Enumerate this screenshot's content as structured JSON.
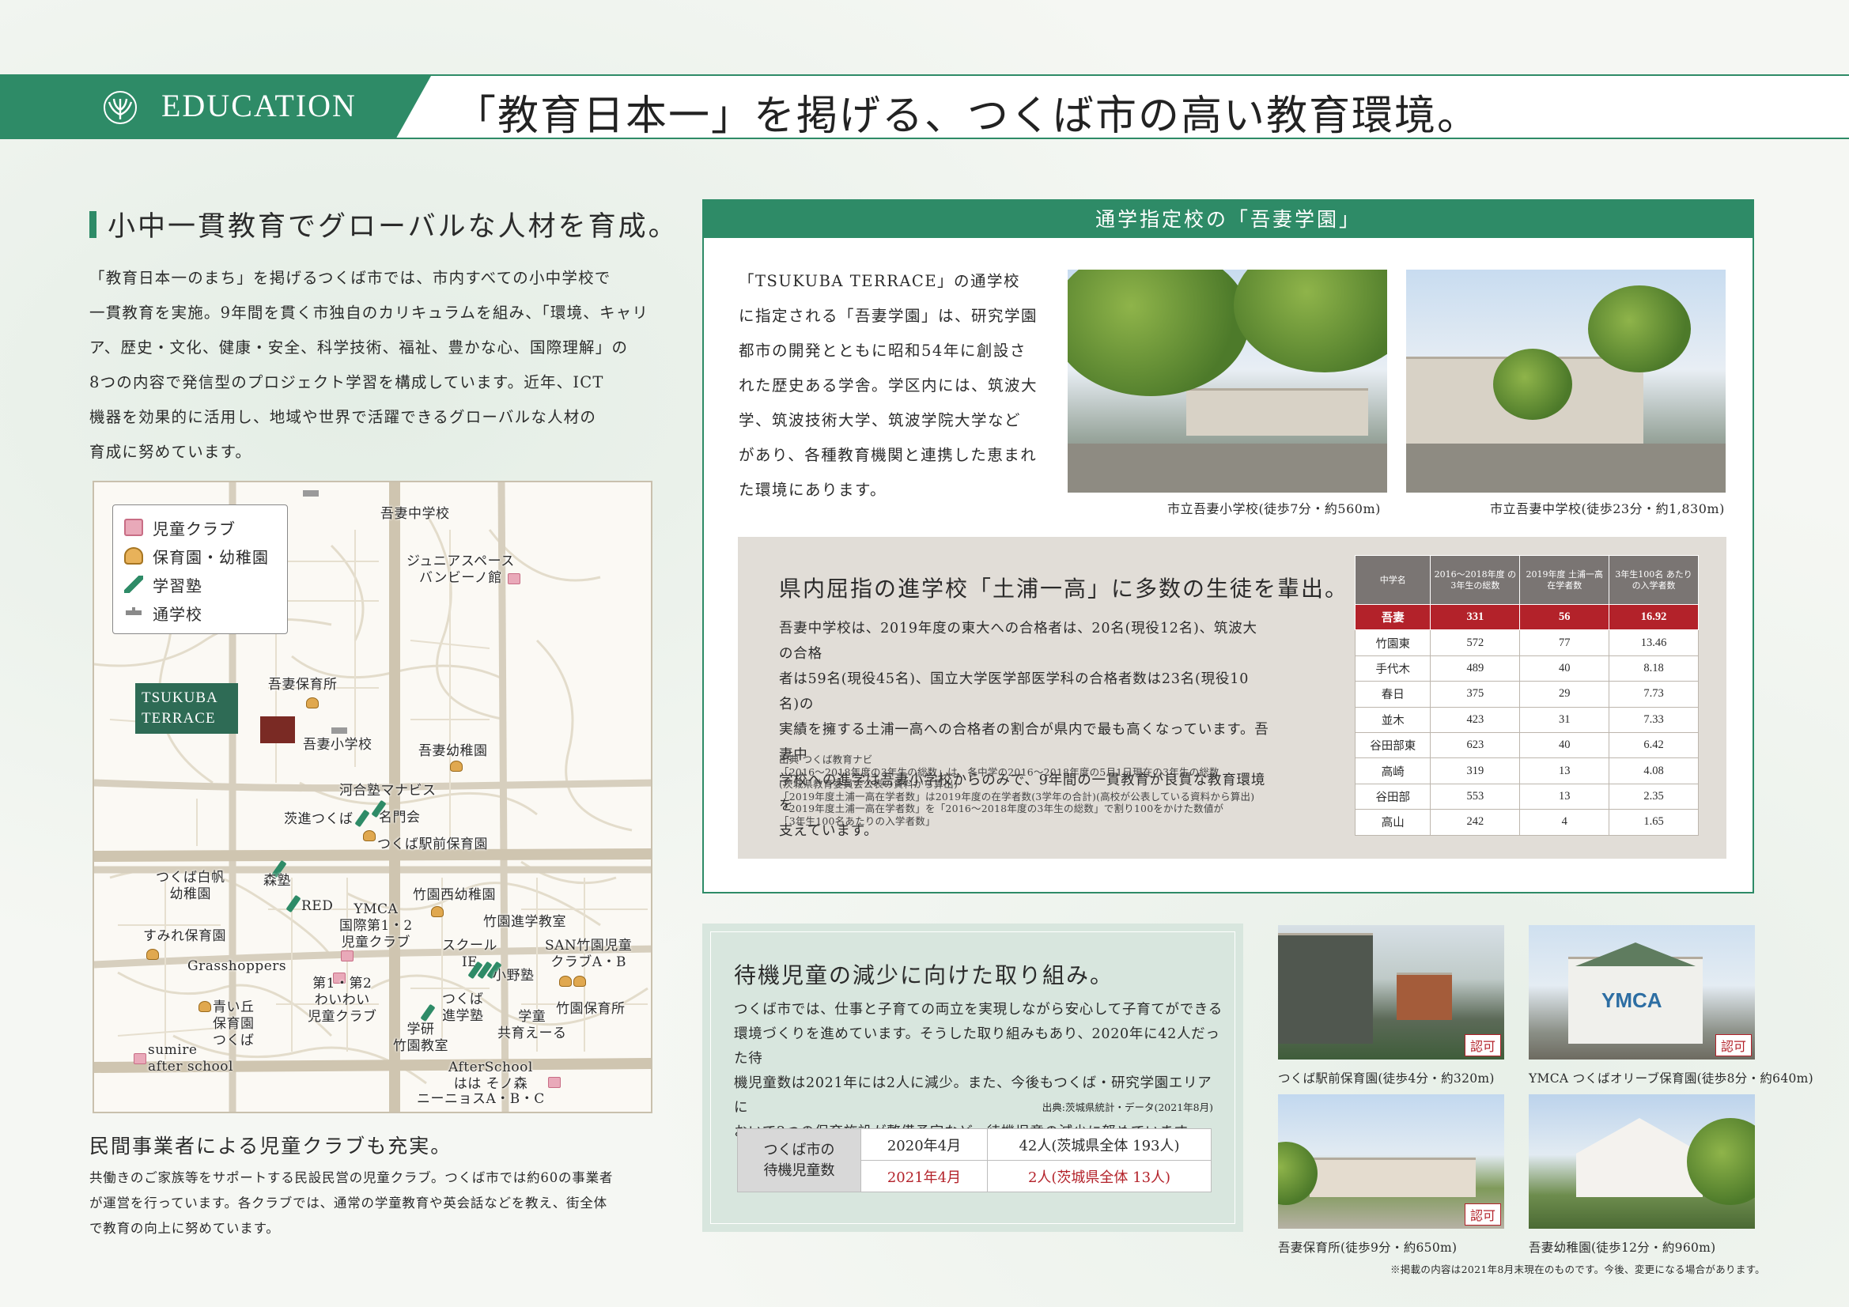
{
  "header": {
    "tag": "EDUCATION",
    "headline": "「教育日本一」を掲げる、つくば市の高い教育環境。"
  },
  "left": {
    "title": "小中一貫教育でグローバルな人材を育成。",
    "lines": [
      "「教育日本一のまち」を掲げるつくば市では、市内すべての小中学校で",
      "一貫教育を実施。9年間を貫く市独自のカリキュラムを組み、「環境、キャリ",
      "ア、歴史・文化、健康・安全、科学技術、福祉、豊かな心、国際理解」の",
      "8つの内容で発信型のプロジェクト学習を構成しています。近年、ICT",
      "機器を効果的に活用し、地域や世界で活躍できるグローバルな人材の",
      "育成に努めています。"
    ],
    "sub_title": "民間事業者による児童クラブも充実。",
    "sub_lines": [
      "共働きのご家族等をサポートする民設民営の児童クラブ。つくば市では約60の事業者",
      "が運営を行っています。各クラブでは、通常の学童教育や英会話などを教え、街全体",
      "で教育の向上に努めています。"
    ]
  },
  "map": {
    "legend": [
      "児童クラブ",
      "保育園・幼稚園",
      "学習塾",
      "通学校"
    ],
    "property": [
      "TSUKUBA",
      "TERRACE"
    ],
    "labels": {
      "azuma_jhs": "吾妻中学校",
      "junior_space": [
        "ジュニアスペース",
        "バンビーノ館"
      ],
      "azuma_nursery": "吾妻保育所",
      "azuma_es": "吾妻小学校",
      "azuma_kg": "吾妻幼稚園",
      "kawai": "河合塾マナビス",
      "ibashin": "茨進つくば",
      "meimonkai": "名門会",
      "station_nursery": "つくば駅前保育園",
      "shiraho": [
        "つくば白帆",
        "幼稚園"
      ],
      "morijuku": "森塾",
      "red": "RED",
      "takezono_kg": "竹園西幼稚園",
      "ymca": [
        "YMCA",
        "国際第1・2",
        "児童クラブ"
      ],
      "takezono_shingaku": "竹園進学教室",
      "sumire": "すみれ保育園",
      "grasshoppers": "Grasshoppers",
      "school_ie": [
        "スクール",
        "IE"
      ],
      "onojuku": "小野塾",
      "san": [
        "SAN竹園児童",
        "クラブA・B"
      ],
      "waiwai": [
        "第1・第2",
        "わいわい",
        "児童クラブ"
      ],
      "aoigaoka": [
        "青い丘",
        "保育園",
        "つくば"
      ],
      "tsukuba_shingaku": [
        "つくば",
        "進学塾"
      ],
      "gakudou": [
        "学童",
        "共育えーる"
      ],
      "takezono_hoiku": "竹園保育所",
      "gakken": [
        "学研",
        "竹園教室"
      ],
      "sumire_after": [
        "sumire",
        "after school"
      ],
      "afterschool": [
        "AfterSchool",
        "はは そノ森"
      ],
      "nineos": "ニーニョスA・B・C"
    }
  },
  "panel": {
    "head": "通学指定校の「吾妻学園」",
    "lines": [
      "「TSUKUBA TERRACE」の通学校",
      "に指定される「吾妻学園」は、研究学園",
      "都市の開発とともに昭和54年に創設さ",
      "れた歴史ある学舎。学区内には、筑波大",
      "学、筑波技術大学、筑波学院大学など",
      "があり、各種教育機関と連携した恵まれ",
      "た環境にあります。"
    ],
    "photo1_caption": "市立吾妻小学校(徒歩7分・約560m)",
    "photo2_caption": "市立吾妻中学校(徒歩23分・約1,830m)"
  },
  "stat": {
    "title": "県内屈指の進学校「土浦一高」に多数の生徒を輩出。",
    "lines": [
      "吾妻中学校は、2019年度の東大への合格者は、20名(現役12名)、筑波大の合格",
      "者は59名(現役45名)、国立大学医学部医学科の合格者数は23名(現役10名)の",
      "実績を擁する土浦一高への合格者の割合が県内で最も高くなっています。吾妻中",
      "学校への進学は吾妻小学校からのみで、9年間の一貫教育が良質な教育環境を",
      "支えています。"
    ],
    "source": [
      "出典 つくば教育ナビ",
      "「2016〜2018年度の3年生の総数」は、各中学の2016〜2018年度の5月1日現在の3年生の総数",
      "(茨城県教育委員会公表の資料から算出)",
      "「2019年度土浦一高在学者数」は2019年度の在学者数(3学年の合計)(高校が公表している資料から算出)",
      "「2019年度土浦一高在学者数」を「2016〜2018年度の3年生の総数」で割り100をかけた数値が",
      "「3年生100名あたりの入学者数」"
    ],
    "table": {
      "headers": [
        "中学名",
        "2016〜2018年度 の3年生の総数",
        "2019年度 土浦一高在学者数",
        "3年生100名 あたりの入学者数"
      ],
      "rows": [
        [
          "吾妻",
          "331",
          "56",
          "16.92"
        ],
        [
          "竹園東",
          "572",
          "77",
          "13.46"
        ],
        [
          "手代木",
          "489",
          "40",
          "8.18"
        ],
        [
          "春日",
          "375",
          "29",
          "7.73"
        ],
        [
          "並木",
          "423",
          "31",
          "7.33"
        ],
        [
          "谷田部東",
          "623",
          "40",
          "6.42"
        ],
        [
          "高崎",
          "319",
          "13",
          "4.08"
        ],
        [
          "谷田部",
          "553",
          "13",
          "2.35"
        ],
        [
          "高山",
          "242",
          "4",
          "1.65"
        ]
      ]
    }
  },
  "wait": {
    "title": "待機児童の減少に向けた取り組み。",
    "lines": [
      "つくば市では、仕事と子育ての両立を実現しながら安心して子育てができる",
      "環境づくりを進めています。そうした取り組みもあり、2020年に42人だった待",
      "機児童数は2021年には2人に減少。また、今後もつくば・研究学園エリアに",
      "おいて2つの保育施設が整備予定など、待機児童の減少に努めています。"
    ],
    "source": "出典:茨城県統計・データ(2021年8月)",
    "table_head": [
      "つくば市の",
      "待機児童数"
    ],
    "rows": [
      [
        "2020年4月",
        "42人(茨城県全体 193人)"
      ],
      [
        "2021年4月",
        "2人(茨城県全体 13人)"
      ]
    ]
  },
  "facilities": {
    "badge": "認可",
    "captions": [
      "つくば駅前保育園(徒歩4分・約320m)",
      "YMCA つくばオリーブ保育園(徒歩8分・約640m)",
      "吾妻保育所(徒歩9分・約650m)",
      "吾妻幼稚園(徒歩12分・約960m)"
    ],
    "ymca_sign": "YMCA"
  },
  "footnote": "※掲載の内容は2021年8月末現在のものです。今後、変更になる場合があります。"
}
